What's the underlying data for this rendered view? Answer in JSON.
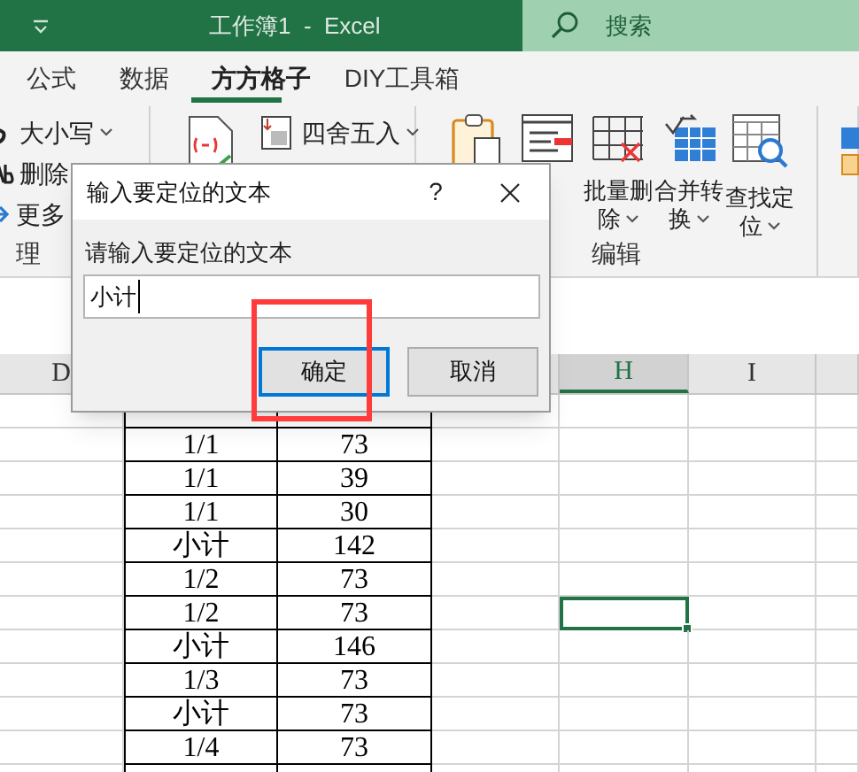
{
  "window": {
    "title": "工作簿1  -  Excel",
    "search_placeholder": "搜索"
  },
  "tabs": [
    {
      "label": "公式",
      "selected": false
    },
    {
      "label": "数据",
      "selected": false
    },
    {
      "label": "方方格子",
      "selected": true
    },
    {
      "label": "DIY工具箱",
      "selected": false
    }
  ],
  "ribbon": {
    "groups": [
      {
        "label": "理",
        "items": [
          {
            "kind": "small",
            "label": "大小写"
          },
          {
            "kind": "small",
            "label": "删除"
          },
          {
            "kind": "small",
            "label": "更多"
          }
        ]
      },
      {
        "items": [
          {
            "kind": "large"
          },
          {
            "kind": "small",
            "label": "四舍五入"
          }
        ]
      },
      {
        "label": "编辑",
        "items": [
          {
            "kind": "large"
          },
          {
            "kind": "large"
          },
          {
            "kind": "large",
            "label_lines": [
              "批量删",
              "除"
            ]
          },
          {
            "kind": "large",
            "label_lines": [
              "合并转",
              "换"
            ]
          },
          {
            "kind": "large",
            "label_lines": [
              "查找定",
              "位"
            ]
          }
        ]
      },
      {
        "items": [
          {
            "kind": "icon"
          }
        ]
      }
    ]
  },
  "sheet": {
    "columns": [
      {
        "label": "D",
        "selected": false
      },
      {
        "label": "H",
        "selected": true
      },
      {
        "label": "I",
        "selected": false
      }
    ],
    "rows": [
      {
        "cells": [
          "1/1",
          "73"
        ],
        "h_selected": false
      },
      {
        "cells": [
          "1/1",
          "39"
        ],
        "h_selected": false
      },
      {
        "cells": [
          "1/1",
          "30"
        ],
        "h_selected": false
      },
      {
        "cells": [
          "小计",
          "142"
        ],
        "h_selected": false
      },
      {
        "cells": [
          "1/2",
          "73"
        ],
        "h_selected": false
      },
      {
        "cells": [
          "1/2",
          "73"
        ],
        "h_selected": true
      },
      {
        "cells": [
          "小计",
          "146"
        ],
        "h_selected": false
      },
      {
        "cells": [
          "1/3",
          "73"
        ],
        "h_selected": false
      },
      {
        "cells": [
          "小计",
          "73"
        ],
        "h_selected": false
      },
      {
        "cells": [
          "1/4",
          "73"
        ],
        "h_selected": false
      }
    ]
  },
  "dialog": {
    "title": "输入要定位的文本",
    "help": "?",
    "label": "请输入要定位的文本",
    "value": "小计",
    "buttons": [
      {
        "label": "确定",
        "focused": true
      },
      {
        "label": "取消",
        "focused": false
      }
    ],
    "highlight": true
  }
}
